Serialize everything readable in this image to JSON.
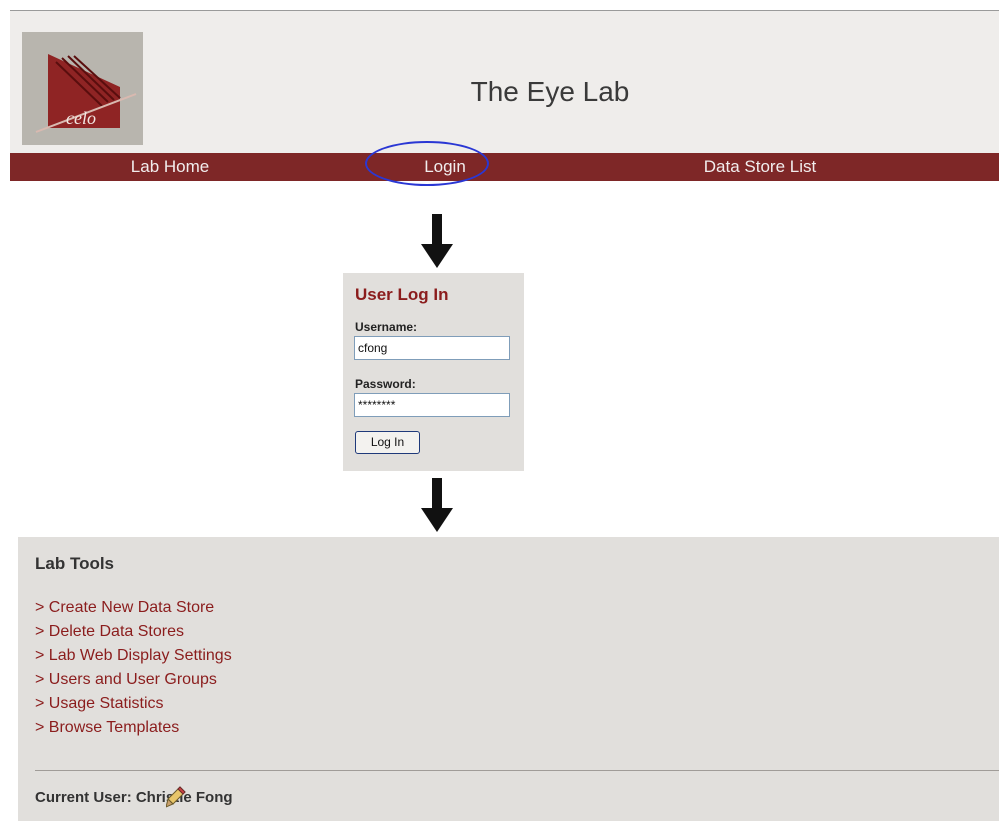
{
  "header": {
    "logo_text": "celo",
    "site_title": "The Eye Lab"
  },
  "nav": {
    "items": [
      {
        "label": "Lab Home"
      },
      {
        "label": "Login"
      },
      {
        "label": "Data Store List"
      }
    ]
  },
  "login": {
    "title": "User Log In",
    "username_label": "Username:",
    "username_value": "cfong",
    "password_label": "Password:",
    "password_value": "********",
    "button_label": "Log In"
  },
  "lab_tools": {
    "title": "Lab Tools",
    "items": [
      "> Create New Data Store",
      "> Delete Data Stores",
      "> Lab Web Display Settings",
      "> Users and User Groups",
      "> Usage Statistics",
      "> Browse Templates"
    ],
    "current_user": "Current User: Christie Fong"
  },
  "colors": {
    "nav_bg": "#7e2727",
    "accent_red": "#8b1d1d",
    "highlight_ellipse": "#2a37d4",
    "panel_bg": "#e1dfdc"
  },
  "icons": [
    "down-arrow-icon",
    "pencil-icon"
  ]
}
